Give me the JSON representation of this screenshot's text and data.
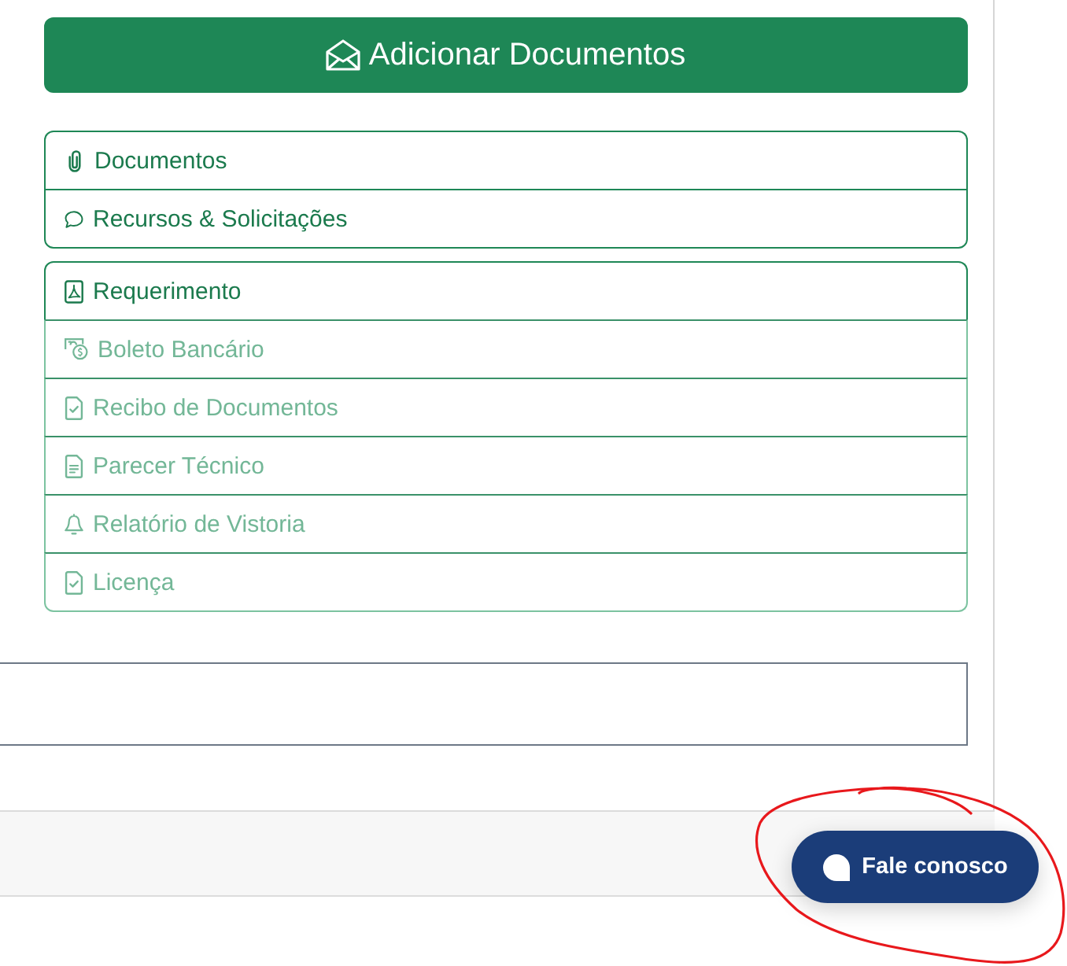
{
  "add_button": {
    "label": "Adicionar Documentos"
  },
  "document_menu": [
    {
      "label": "Documentos",
      "disabled": false
    },
    {
      "label": "Recursos & Solicitações",
      "disabled": false
    }
  ],
  "report_menu": [
    {
      "label": "Requerimento",
      "disabled": false
    },
    {
      "label": "Boleto Bancário",
      "disabled": true
    },
    {
      "label": "Recibo de Documentos",
      "disabled": true
    },
    {
      "label": "Parecer Técnico",
      "disabled": true
    },
    {
      "label": "Relatório de Vistoria",
      "disabled": true
    },
    {
      "label": "Licença",
      "disabled": true
    }
  ],
  "chat_button": {
    "label": "Fale conosco"
  }
}
